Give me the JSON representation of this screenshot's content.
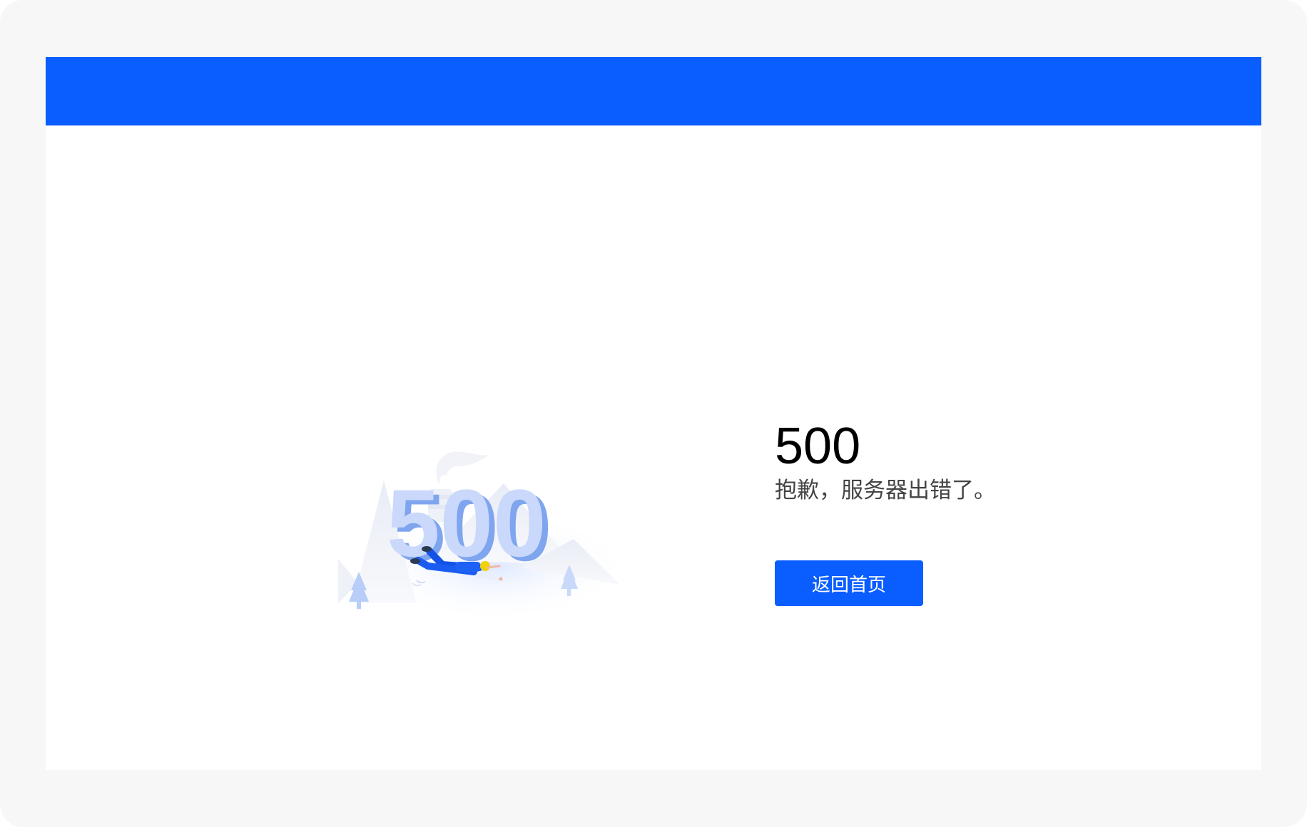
{
  "error": {
    "code": "500",
    "message": "抱歉，服务器出错了。",
    "home_button_label": "返回首页"
  },
  "illustration": {
    "number_text": "500"
  },
  "colors": {
    "accent": "#0a5dff",
    "frame": "#f7f7f8",
    "text_primary": "#000000",
    "text_secondary": "#444444"
  }
}
